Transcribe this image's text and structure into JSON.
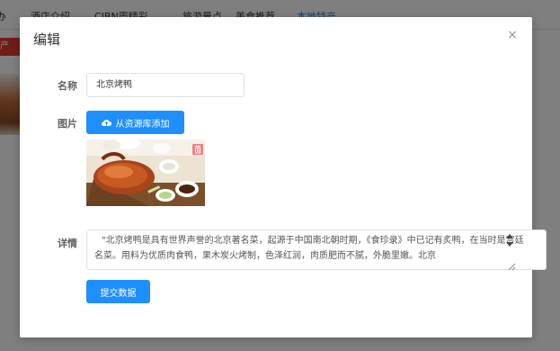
{
  "background": {
    "nav_tabs": [
      "办",
      "酒店介绍",
      "CIBN周精彩",
      "旅游景点",
      "美食推荐",
      "本地特产"
    ],
    "active_tab_index": 5,
    "red_tag": "产",
    "accent_color": "#1e88e5"
  },
  "modal": {
    "title": "编辑",
    "close_icon": "×",
    "name_label": "名称",
    "name_value": "北京烤鸭",
    "image_label": "图片",
    "upload_button": "从资源库添加",
    "image_alt": "北京烤鸭",
    "details_label": "详情",
    "details_value": "\"北京烤鸭是具有世界声誉的北京著名菜，起源于中国南北朝时期，《食珍录》中已记有炙鸭，在当时是宫廷名菜。用料为优质肉食鸭，果木炭火烤制，色泽红润，肉质肥而不腻，外脆里嫩。北京",
    "submit_button": "提交数据",
    "primary_color": "#1e8fff",
    "delete_color": "#f56c6c"
  }
}
